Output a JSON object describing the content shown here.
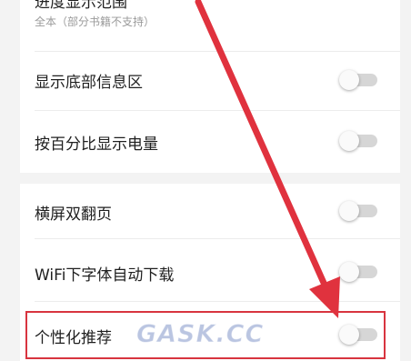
{
  "settings": {
    "progress_range": {
      "label": "进度显示范围",
      "value": "全本（部分书籍不支持）"
    },
    "items": [
      {
        "label": "显示底部信息区",
        "enabled": false
      },
      {
        "label": "按百分比显示电量",
        "enabled": false
      },
      {
        "label": "横屏双翻页",
        "enabled": false
      },
      {
        "label": "WiFi下字体自动下载",
        "enabled": false
      },
      {
        "label": "个性化推荐",
        "enabled": false
      }
    ]
  },
  "annotation": {
    "highlight_color": "#d8343f",
    "arrow_color": "#e0323e",
    "watermark": "GASK.CC"
  },
  "colors": {
    "background": "#f3f3f3",
    "panel": "#ffffff",
    "toggle_track_off": "#d6d6d6",
    "toggle_knob": "#fafafa"
  }
}
